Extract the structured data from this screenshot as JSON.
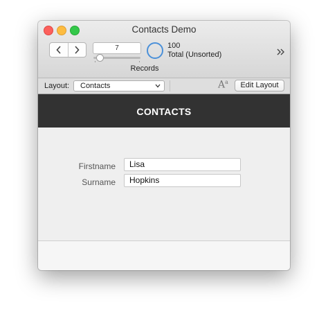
{
  "window": {
    "title": "Contacts Demo"
  },
  "toolbar": {
    "record_number": "7",
    "record_fraction": 0.07,
    "records_label": "Records",
    "total_count": "100",
    "total_label": "Total (Unsorted)"
  },
  "layout_bar": {
    "label": "Layout:",
    "selected_layout": "Contacts",
    "font_icon_main": "A",
    "font_icon_sup": "a",
    "edit_layout_label": "Edit Layout"
  },
  "header": {
    "title": "CONTACTS"
  },
  "fields": [
    {
      "label": "Firstname",
      "value": "Lisa"
    },
    {
      "label": "Surname",
      "value": "Hopkins"
    }
  ],
  "icons": {
    "close": "close-icon",
    "minimize": "minimize-icon",
    "zoom": "zoom-icon",
    "back": "chevron-left-icon",
    "forward": "chevron-right-icon",
    "pie": "record-pie-icon",
    "overflow": "double-chevron-right-icon",
    "select": "chevron-down-icon",
    "font": "font-size-icon"
  },
  "colors": {
    "accent": "#4a90d9",
    "header_band": "#323232",
    "close": "#fc605c",
    "minimize": "#fdbc40",
    "zoom": "#34c84a"
  }
}
